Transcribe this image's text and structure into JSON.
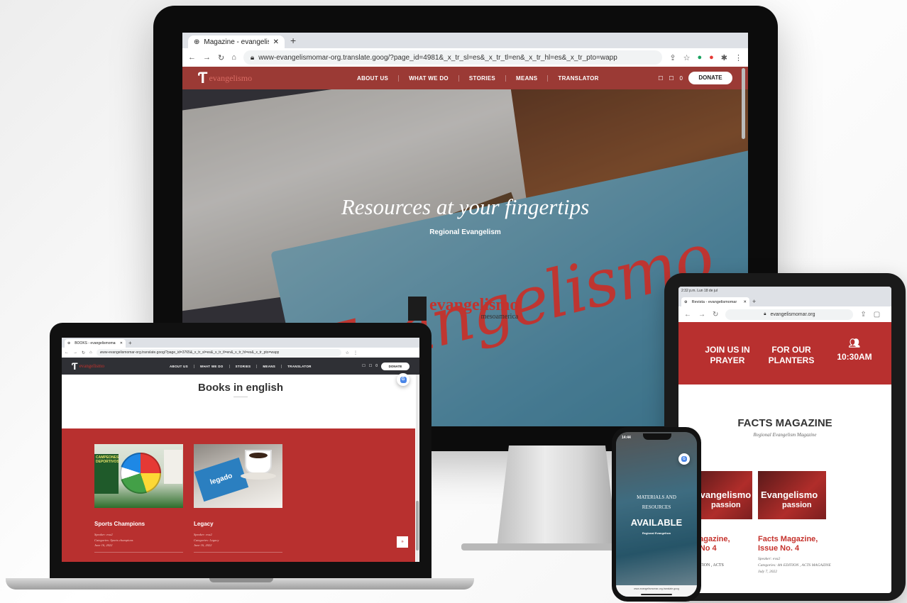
{
  "imac": {
    "tab_title": "Magazine - evangelismomar",
    "url": "www-evangelismomar-org.translate.goog/?page_id=4981&_x_tr_sl=es&_x_tr_tl=en&_x_tr_hl=es&_x_tr_pto=wapp",
    "logo_text": "evangelismo",
    "nav": [
      "ABOUT US",
      "WHAT WE DO",
      "STORIES",
      "MEANS",
      "TRANSLATOR"
    ],
    "cart_count": "0",
    "donate": "DONATE",
    "hero_title": "Resources at your fingertips",
    "hero_subtitle": "Regional Evangelism",
    "hero_script": "Evangelismo",
    "hero_logo_main": "evangelismo",
    "hero_logo_sub": "mesoamerica"
  },
  "laptop": {
    "tab_title": "BOOKS - evangelismomar",
    "url": "www-evangelismomar-org.translate.goog/?page_id=3765&_x_tr_sl=es&_x_tr_tl=en&_x_tr_hl=es&_x_tr_pto=wapp",
    "logo_text": "evangelismo",
    "nav": [
      "ABOUT US",
      "WHAT WE DO",
      "STORIES",
      "MEANS",
      "TRANSLATOR"
    ],
    "cart_count": "0",
    "donate": "DONATE",
    "heading": "Books in english",
    "cards": [
      {
        "title": "Sports Champions",
        "speaker": "Speaker: eva2",
        "categories": "Categories: Sports champions",
        "date": "June 16, 2022"
      },
      {
        "title": "Legacy",
        "speaker": "Speaker: eva2",
        "categories": "Categories: Legacy",
        "date": "June 16, 2022"
      }
    ],
    "ball_banner": "CAMPEONES DEPORTIVOS",
    "book_label": "legado"
  },
  "tablet": {
    "status_time": "2:32 p.m.  Lun 18 de jul",
    "tab_title": "Revista - evangelismomar",
    "url": "evangelismomar.org",
    "banner": [
      "JOIN US IN PRAYER",
      "FOR OUR PLANTERS",
      "10:30AM"
    ],
    "heading": "FACTS MAGAZINE",
    "subheading": "Regional Evangelism Magazine",
    "cover_word": "Evangelismo",
    "cover_word2": "passion",
    "issues": [
      {
        "title_line1": "Magazine,",
        "title_line2": "n No 4",
        "meta": "EDITION , ACTS"
      },
      {
        "title_line1": "Facts Magazine,",
        "title_line2": "Issue No. 4",
        "speaker": "Speaker: eva2",
        "categories": "Categories: 4th EDITION , ACTS MAGAZINE",
        "date": "July 7, 2022"
      }
    ]
  },
  "phone": {
    "time": "14:44",
    "line1": "MATERIALS AND",
    "line2": "RESOURCES",
    "headline": "AVAILABLE",
    "sub": "Regional Evangelism",
    "url": "www-evangelismomar-org.translate.goog"
  },
  "colors": {
    "brand_red": "#b8302f",
    "nav_dark": "#2f3035",
    "nav_red": "#9b3a35"
  }
}
